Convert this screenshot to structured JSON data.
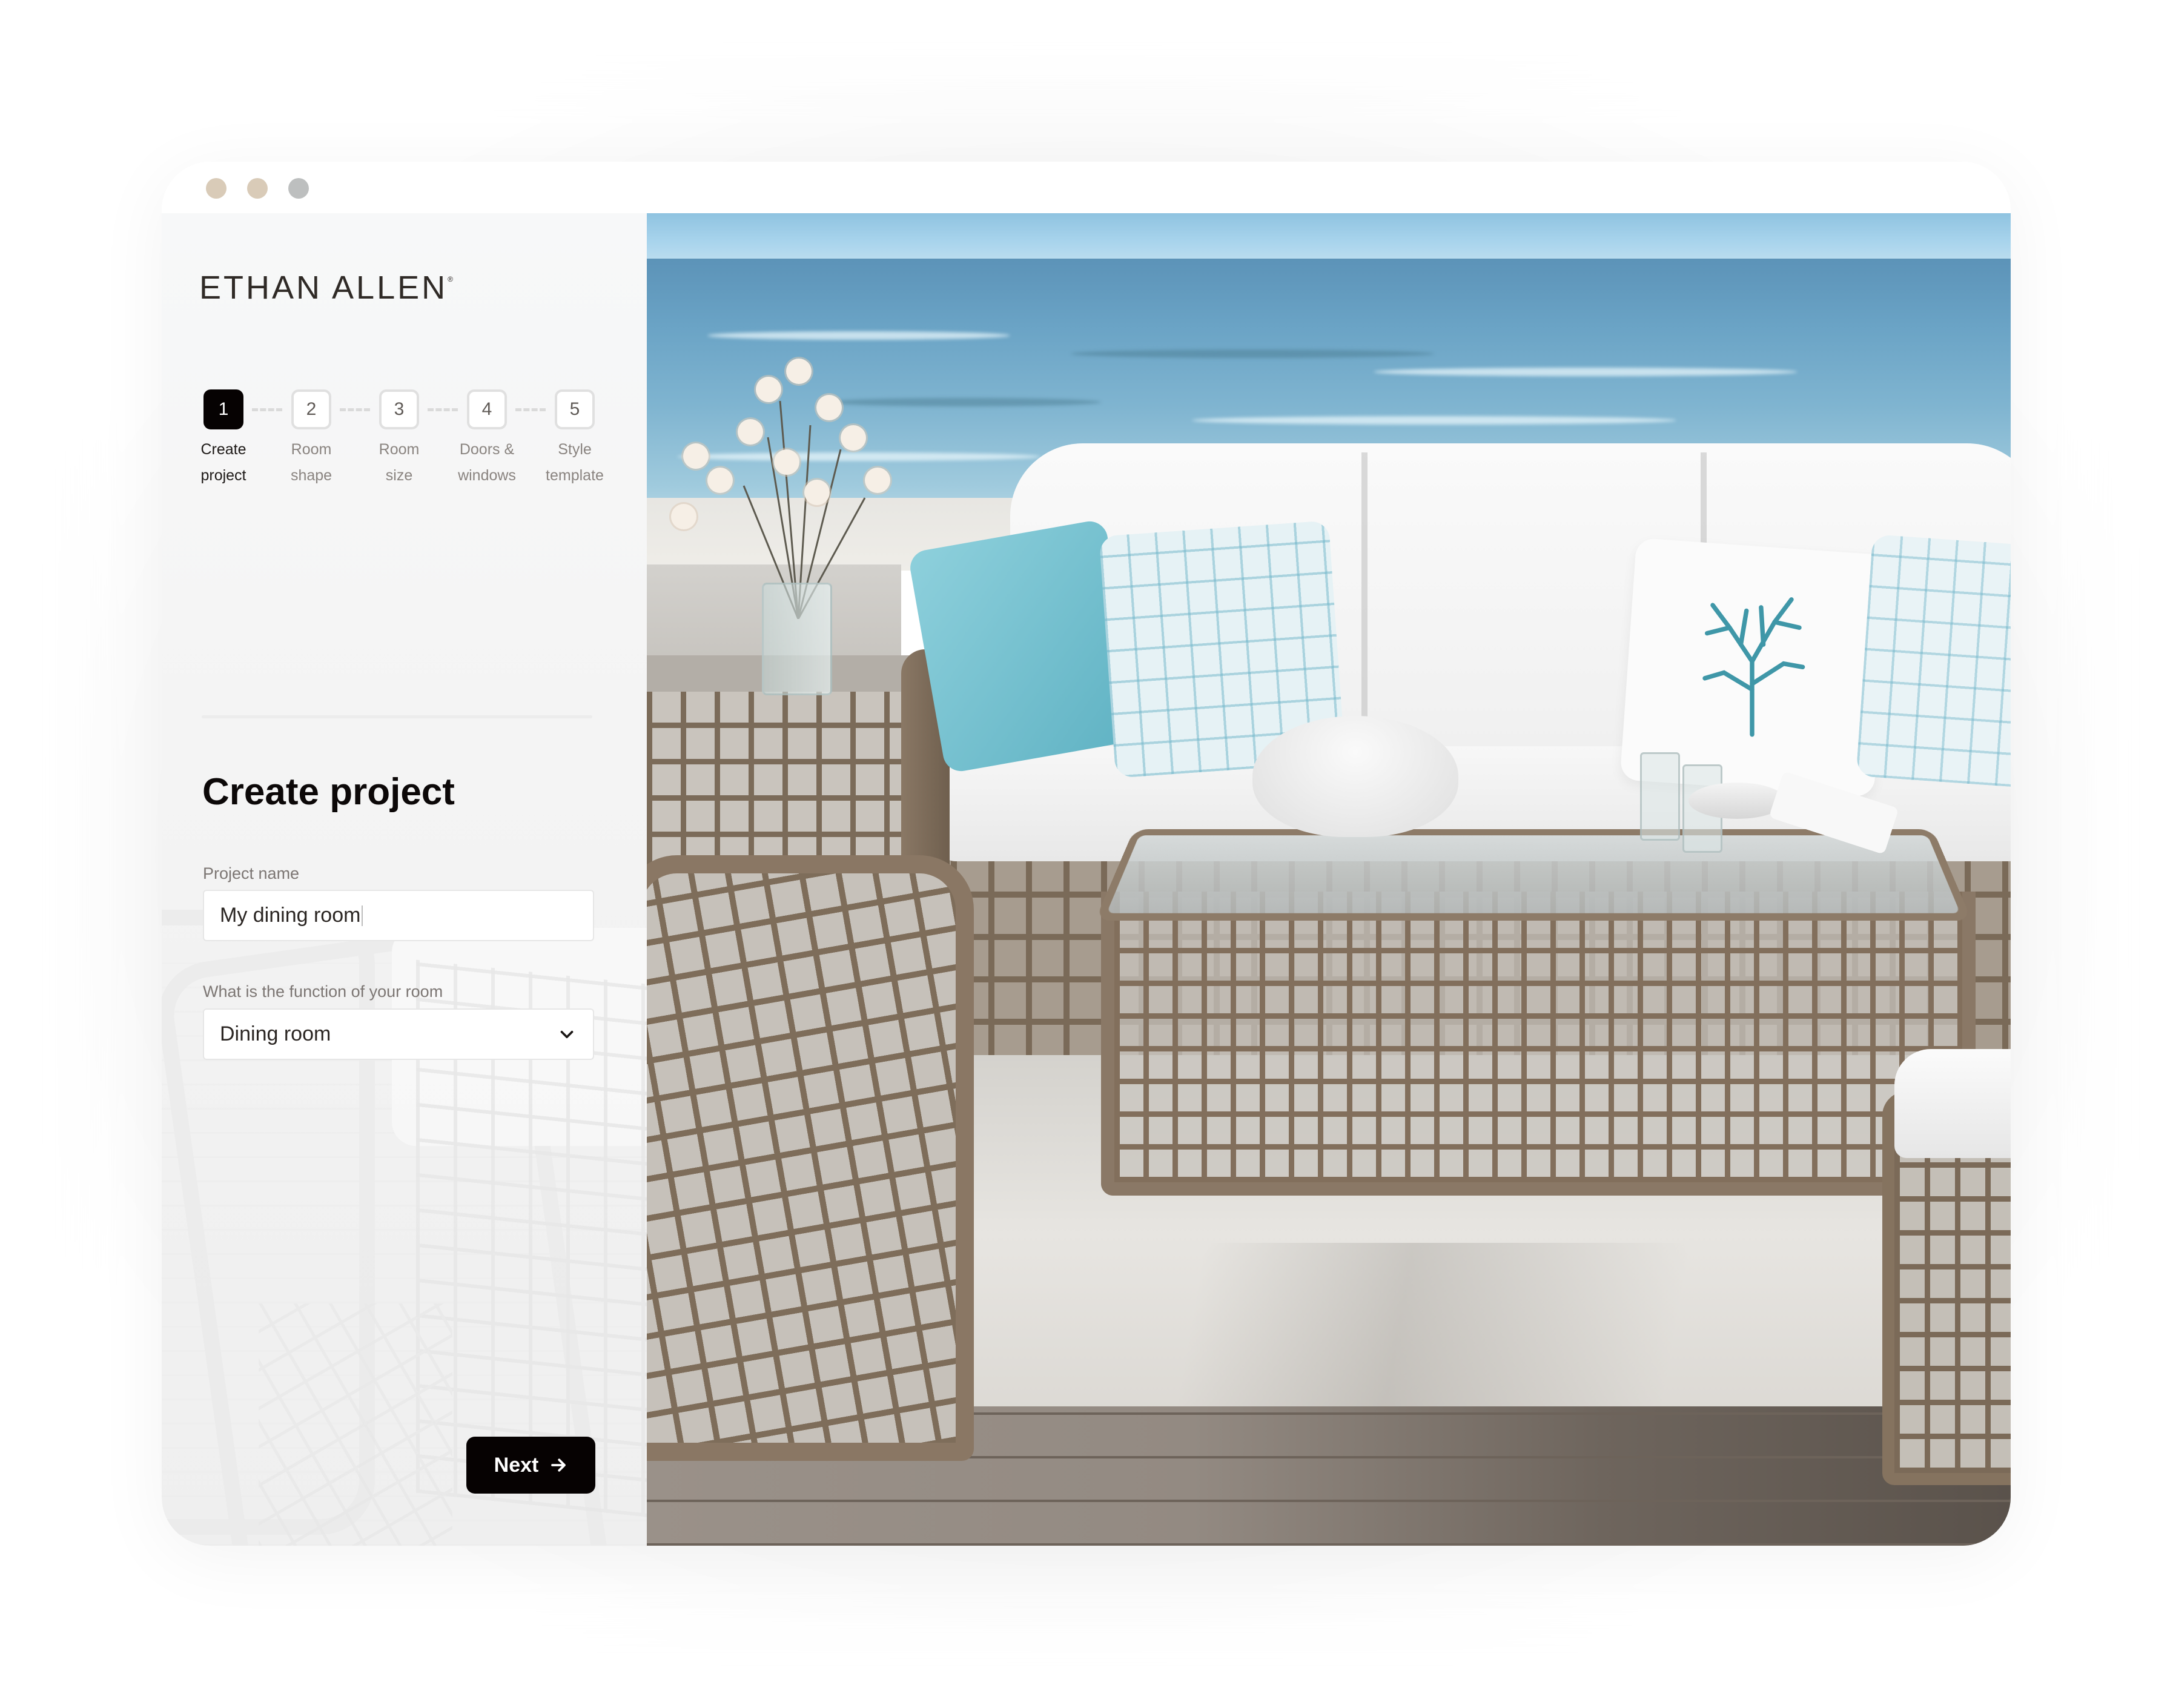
{
  "window": {
    "traffic_lights": [
      {
        "name": "close",
        "color": "#d9cbb8"
      },
      {
        "name": "minimize",
        "color": "#d9cbb8"
      },
      {
        "name": "zoom",
        "color": "#bdbfbf"
      }
    ]
  },
  "brand": {
    "logo_text": "ETHAN ALLEN",
    "trademark": "®"
  },
  "stepper": {
    "current_step": 1,
    "steps": [
      {
        "number": "1",
        "line1": "Create",
        "line2": "project",
        "active": true
      },
      {
        "number": "2",
        "line1": "Room",
        "line2": "shape",
        "active": false
      },
      {
        "number": "3",
        "line1": "Room",
        "line2": "size",
        "active": false
      },
      {
        "number": "4",
        "line1": "Doors &",
        "line2": "windows",
        "active": false
      },
      {
        "number": "5",
        "line1": "Style",
        "line2": "template",
        "active": false
      }
    ]
  },
  "form": {
    "title": "Create project",
    "project_name": {
      "label": "Project name",
      "value": "My dining room"
    },
    "room_function": {
      "label": "What is the function of your room",
      "selected": "Dining room"
    },
    "next_label": "Next"
  },
  "colors": {
    "primary": "#060202",
    "step_border": "#e0e0e0",
    "muted_text": "#8a8480"
  },
  "hero_image": {
    "description": "Outdoor wicker sofa set with white cushions and teal pillows on a deck overlooking the ocean"
  }
}
